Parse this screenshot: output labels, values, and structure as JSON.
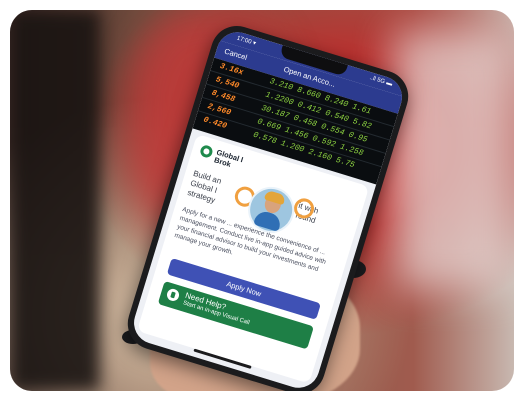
{
  "status_bar": {
    "time": "17:00 ▾",
    "signal": "..ll 5G ▬"
  },
  "nav": {
    "cancel_label": "Cancel",
    "title": "Open an Acco..."
  },
  "ticker": [
    {
      "value": "3.16x",
      "change": "3.210  8.660  8.240  1.61"
    },
    {
      "value": "5,540",
      "change": "1.2200  0.412  0.540  5.82"
    },
    {
      "value": "8,458",
      "change": "30.187  0.458  0.554  0.95"
    },
    {
      "value": "2,560",
      "change": "0.669  1.456  0.592  1.258"
    },
    {
      "value": "0.420",
      "change": "0.578  1.200  2.160  5.75"
    }
  ],
  "card": {
    "brand_line1": "Global I",
    "brand_line2": "Brok",
    "headline_left": "Build an\nGlobal I\nstrategy",
    "headline_right": "it with\nround",
    "body": "Apply for a new ... experience the convenience of ... management. Conduct live in-app guided advice with your financial advisor to build your investments and manage your growth.",
    "apply_label": "Apply Now",
    "help_title": "Need Help?",
    "help_sub": "Start an in-app Visual Call"
  },
  "colors": {
    "brand_navy": "#2c3b8f",
    "apply_blue": "#3f51b5",
    "help_green": "#1e7f46",
    "ticker_orange": "#ff8a2a",
    "ticker_green": "#8fd642"
  }
}
